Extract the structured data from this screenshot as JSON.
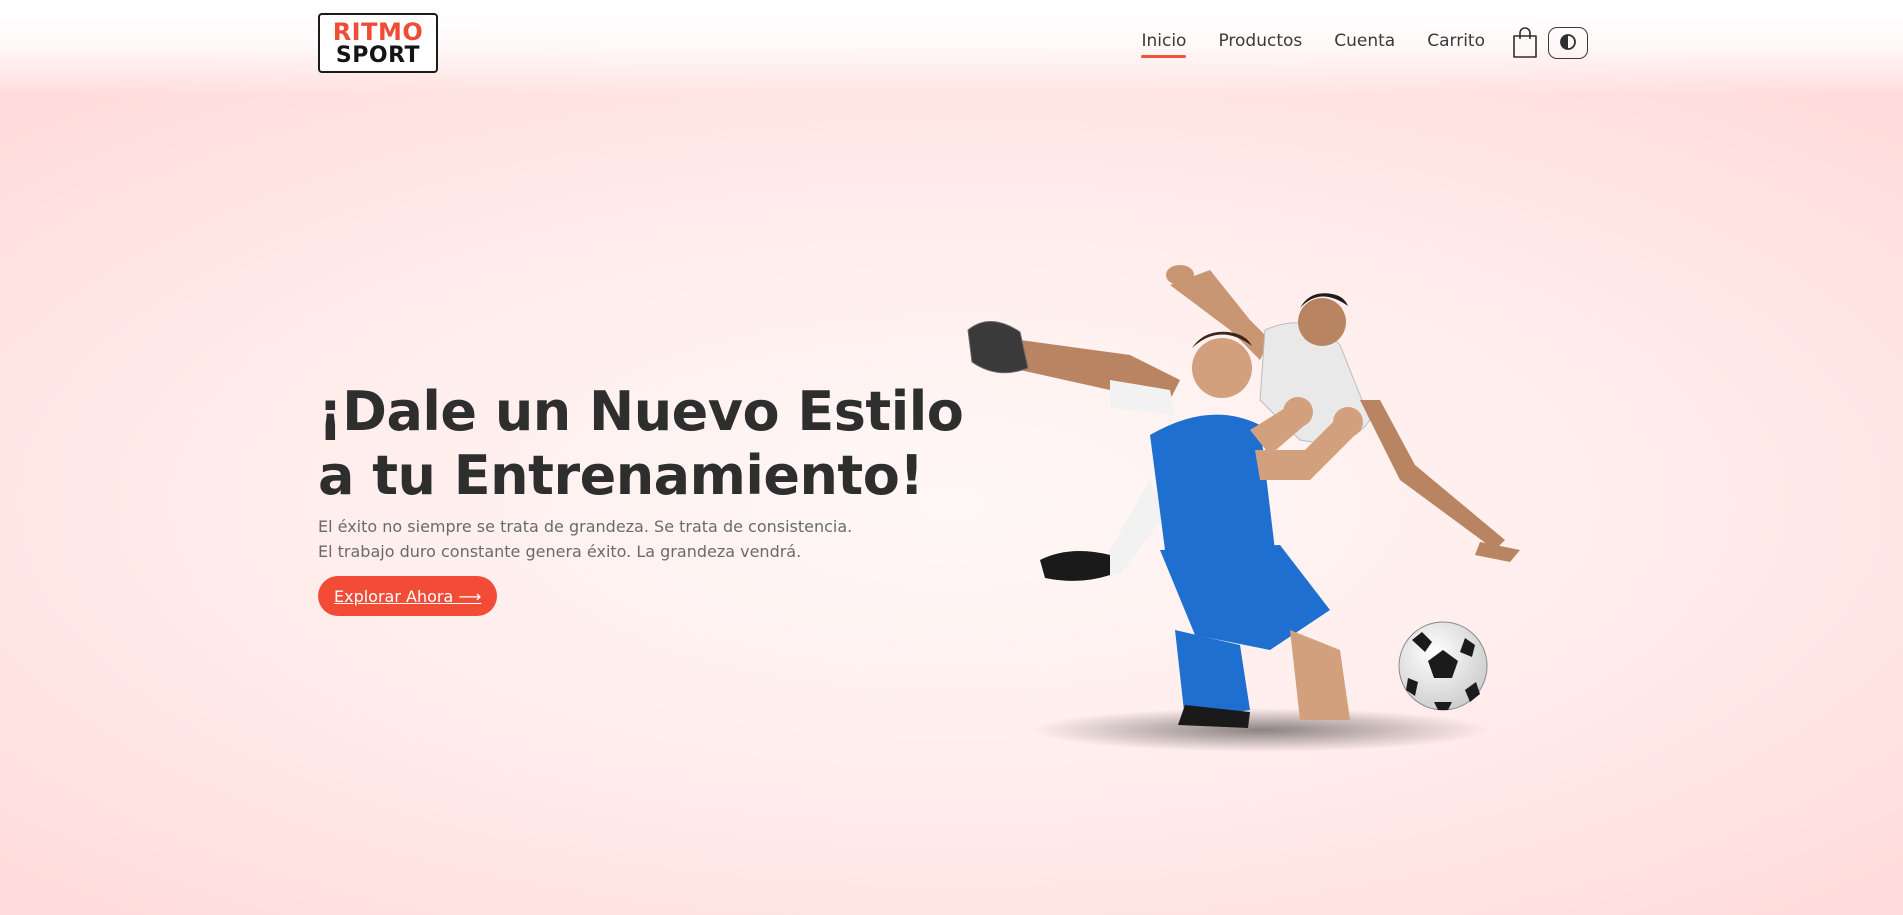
{
  "brand": {
    "line1": "RITMO",
    "line2": "SPORT"
  },
  "nav": {
    "items": [
      {
        "label": "Inicio",
        "active": true
      },
      {
        "label": "Productos",
        "active": false
      },
      {
        "label": "Cuenta",
        "active": false
      },
      {
        "label": "Carrito",
        "active": false
      }
    ],
    "cart_icon": "shopping-bag-icon",
    "theme_icon": "contrast-half-circle-icon"
  },
  "hero": {
    "title_line1": "¡Dale un Nuevo Estilo",
    "title_line2": "a tu Entrenamiento!",
    "subtitle_line1": "El éxito no siempre se trata de grandeza. Se trata de consistencia.",
    "subtitle_line2": "El trabajo duro constante genera éxito. La grandeza vendrá.",
    "cta_label": "Explorar Ahora ⟶"
  },
  "colors": {
    "accent": "#f24c37",
    "text_dark": "#2e2e2e",
    "text_muted": "#6a6a6a",
    "background": "#ffeceb",
    "jersey_blue": "#1f6fd1",
    "jersey_white": "#eeeeee"
  }
}
